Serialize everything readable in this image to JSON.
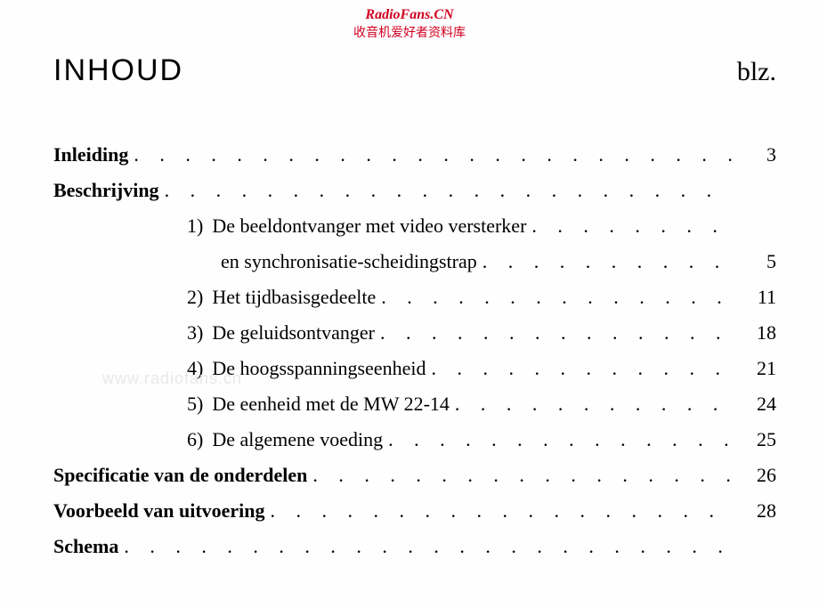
{
  "watermark": {
    "top_line1": "RadioFans.CN",
    "top_line2": "收音机爱好者资料库",
    "side": "www.radiofans.cn"
  },
  "header": {
    "title": "INHOUD",
    "page_label": "blz."
  },
  "toc": {
    "inleiding": {
      "label": "Inleiding",
      "page": "3"
    },
    "beschrijving": {
      "label": "Beschrijving"
    },
    "items": [
      {
        "num": "1)",
        "text": "De beeldontvanger met video versterker",
        "cont": "en synchronisatie-scheidingstrap",
        "page": "5"
      },
      {
        "num": "2)",
        "text": "Het tijdbasisgedeelte",
        "page": "11"
      },
      {
        "num": "3)",
        "text": "De geluidsontvanger",
        "page": "18"
      },
      {
        "num": "4)",
        "text": "De hoogsspanningseenheid",
        "page": "21"
      },
      {
        "num": "5)",
        "text": "De eenheid met de MW 22-14",
        "page": "24"
      },
      {
        "num": "6)",
        "text": "De algemene voeding",
        "page": "25"
      }
    ],
    "specificatie": {
      "label": "Specificatie van de onderdelen",
      "page": "26"
    },
    "voorbeeld": {
      "label": "Voorbeeld van uitvoering",
      "page": "28"
    },
    "schema": {
      "label": "Schema"
    }
  }
}
